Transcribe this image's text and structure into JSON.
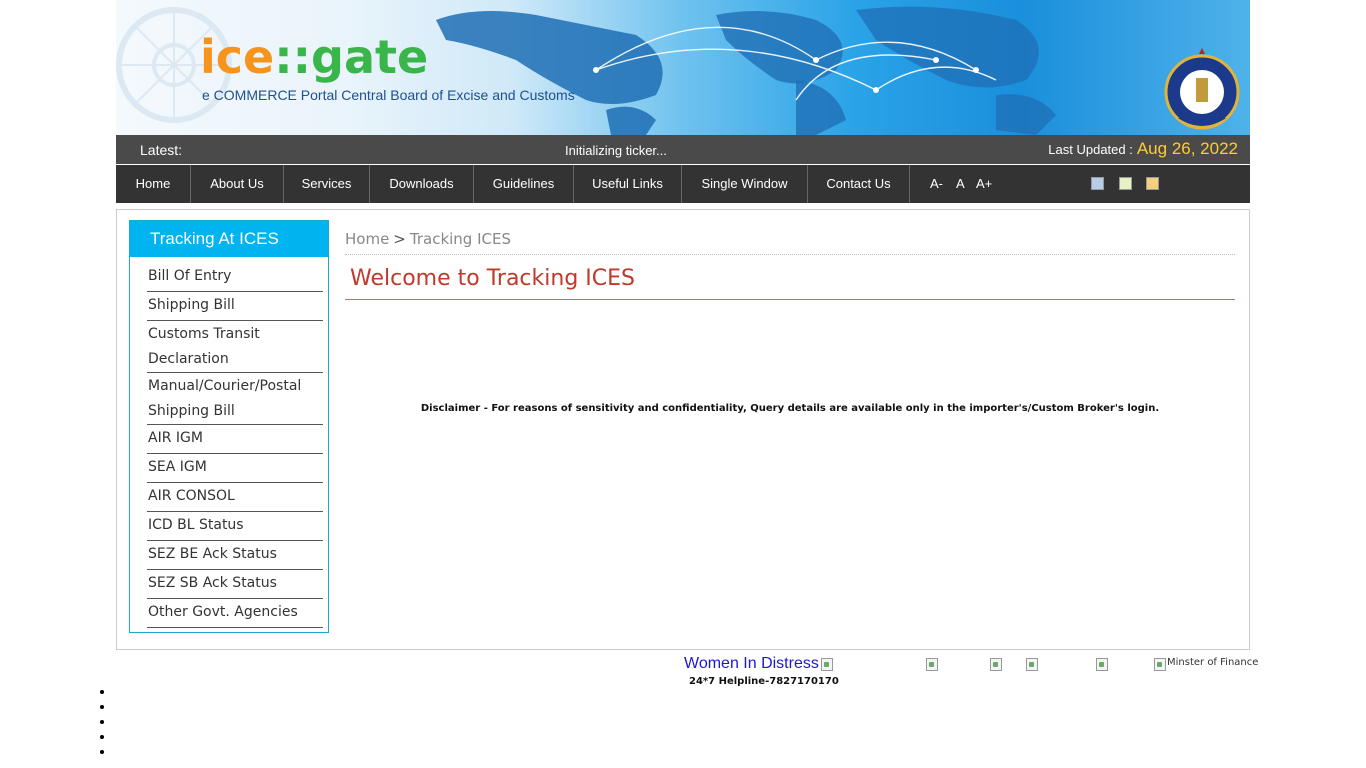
{
  "banner": {
    "logo_ice": "ice",
    "logo_sep": "::",
    "logo_gate": "gate",
    "tagline": "e COMMERCE Portal Central Board of Excise and Customs"
  },
  "ticker": {
    "latest_label": "Latest:",
    "ticker_text": "Initializing ticker...",
    "last_updated_label": "Last Updated :",
    "last_updated_date": "Aug 26, 2022"
  },
  "nav": {
    "items": [
      "Home",
      "About Us",
      "Services",
      "Downloads",
      "Guidelines",
      "Useful Links",
      "Single Window",
      "Contact Us"
    ],
    "font_decrease": "A-",
    "font_normal": "A",
    "font_increase": "A+",
    "theme_colors": [
      "#b8cce8",
      "#e6f2c4",
      "#f5cf7e"
    ]
  },
  "sidebar": {
    "heading": "Tracking At ICES",
    "items": [
      "Bill Of Entry",
      "Shipping Bill",
      "Customs Transit Declaration",
      "Manual/Courier/Postal Shipping Bill",
      "AIR IGM",
      "SEA IGM",
      "AIR CONSOL",
      "ICD BL Status",
      "SEZ BE Ack Status",
      "SEZ SB Ack Status",
      "Other Govt. Agencies"
    ]
  },
  "breadcrumb": {
    "home": "Home",
    "sep": ">",
    "current": "Tracking ICES"
  },
  "main": {
    "title": "Welcome to Tracking ICES",
    "disclaimer": "Disclaimer - For reasons of sensitivity and confidentiality, Query details are available only in the importer's/Custom Broker's login."
  },
  "footer": {
    "women_in_distress": "Women In Distress",
    "helpline": "24*7 Helpline-7827170170",
    "minister_alt": "Minster of Finance"
  }
}
